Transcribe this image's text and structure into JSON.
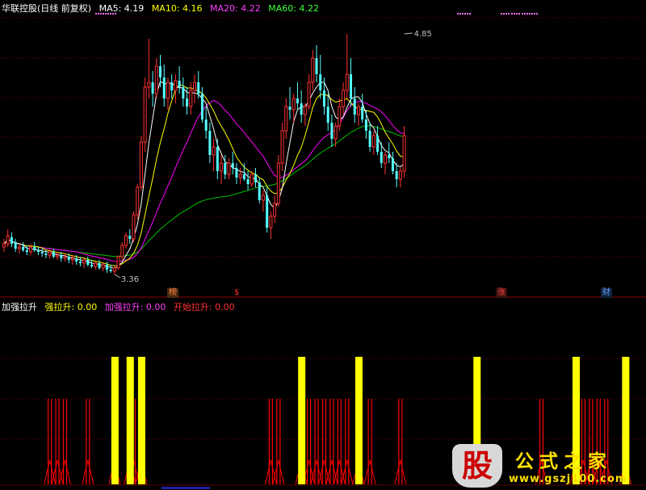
{
  "main_header": {
    "title": "华联控股(日线 前复权)",
    "ma5_label": "MA5: 4.19",
    "ma10_label": "MA10: 4.16",
    "ma20_label": "MA20: 4.22",
    "ma60_label": "MA60: 4.22"
  },
  "indicator_header": {
    "name": "加强拉升",
    "strong_label": "强拉升: 0.00",
    "enhanced_label": "加强拉升: 0.00",
    "start_label": "开始拉升: 0.00"
  },
  "markers": [
    {
      "text": "榜",
      "color": "#ff8040",
      "bg": "#4a2a10"
    },
    {
      "text": "$",
      "color": "#ff3030",
      "bg": "transparent"
    },
    {
      "text": "涨",
      "color": "#ff4040",
      "bg": "#3a1010"
    },
    {
      "text": "财",
      "color": "#60a0ff",
      "bg": "#10203a"
    }
  ],
  "colors": {
    "up": "#ff3232",
    "down": "#54ffff",
    "ma5": "#ffffff",
    "ma10": "#ffff00",
    "ma20": "#ff00ff",
    "ma60": "#00c000",
    "strong_bar": "#ffff00",
    "red_line": "#ff0000",
    "grid": "#7a0000",
    "header_title": "#ffffff",
    "ma5_text": "#ffffff",
    "ma10_text": "#ffff00",
    "ma20_text": "#ff40ff",
    "ma60_text": "#40ff40"
  },
  "watermark": {
    "glyph": "股",
    "title": "公式之家",
    "url": "www.gszj100.com"
  },
  "chart_data": [
    {
      "type": "candlestick",
      "title": "华联控股(日线 前复权)",
      "annotations": [
        {
          "text": "4.85",
          "kind": "high",
          "x": 105,
          "value": 4.85
        },
        {
          "text": "3.36",
          "kind": "low",
          "x": 29,
          "value": 3.36
        }
      ],
      "ylim": [
        3.3,
        4.95
      ],
      "grid": true,
      "candles": [
        [
          3.53,
          3.58,
          3.5,
          3.55
        ],
        [
          3.55,
          3.64,
          3.53,
          3.6
        ],
        [
          3.59,
          3.62,
          3.53,
          3.55
        ],
        [
          3.56,
          3.58,
          3.5,
          3.52
        ],
        [
          3.52,
          3.55,
          3.49,
          3.53
        ],
        [
          3.53,
          3.56,
          3.5,
          3.51
        ],
        [
          3.51,
          3.54,
          3.48,
          3.5
        ],
        [
          3.5,
          3.55,
          3.48,
          3.53
        ],
        [
          3.53,
          3.56,
          3.5,
          3.51
        ],
        [
          3.51,
          3.53,
          3.48,
          3.5
        ],
        [
          3.5,
          3.52,
          3.47,
          3.49
        ],
        [
          3.49,
          3.51,
          3.46,
          3.48
        ],
        [
          3.48,
          3.52,
          3.46,
          3.5
        ],
        [
          3.5,
          3.52,
          3.46,
          3.47
        ],
        [
          3.47,
          3.5,
          3.45,
          3.48
        ],
        [
          3.48,
          3.5,
          3.44,
          3.46
        ],
        [
          3.46,
          3.49,
          3.44,
          3.47
        ],
        [
          3.47,
          3.49,
          3.43,
          3.45
        ],
        [
          3.45,
          3.48,
          3.42,
          3.46
        ],
        [
          3.46,
          3.48,
          3.42,
          3.44
        ],
        [
          3.44,
          3.47,
          3.41,
          3.43
        ],
        [
          3.43,
          3.46,
          3.4,
          3.45
        ],
        [
          3.45,
          3.47,
          3.41,
          3.42
        ],
        [
          3.42,
          3.45,
          3.4,
          3.41
        ],
        [
          3.41,
          3.44,
          3.39,
          3.43
        ],
        [
          3.43,
          3.45,
          3.39,
          3.4
        ],
        [
          3.4,
          3.43,
          3.38,
          3.42
        ],
        [
          3.42,
          3.44,
          3.37,
          3.39
        ],
        [
          3.39,
          3.42,
          3.37,
          3.38
        ],
        [
          3.38,
          3.41,
          3.36,
          3.4
        ],
        [
          3.4,
          3.48,
          3.39,
          3.47
        ],
        [
          3.47,
          3.56,
          3.45,
          3.54
        ],
        [
          3.54,
          3.62,
          3.52,
          3.6
        ],
        [
          3.6,
          3.64,
          3.55,
          3.58
        ],
        [
          3.58,
          3.75,
          3.56,
          3.73
        ],
        [
          3.73,
          3.92,
          3.7,
          3.9
        ],
        [
          3.9,
          4.22,
          3.88,
          4.18
        ],
        [
          4.18,
          4.58,
          4.12,
          4.52
        ],
        [
          4.52,
          4.82,
          4.45,
          4.55
        ],
        [
          4.55,
          4.62,
          4.4,
          4.48
        ],
        [
          4.48,
          4.7,
          4.45,
          4.65
        ],
        [
          4.65,
          4.72,
          4.52,
          4.58
        ],
        [
          4.58,
          4.66,
          4.4,
          4.45
        ],
        [
          4.45,
          4.58,
          4.38,
          4.55
        ],
        [
          4.55,
          4.6,
          4.45,
          4.5
        ],
        [
          4.5,
          4.6,
          4.42,
          4.56
        ],
        [
          4.56,
          4.65,
          4.48,
          4.52
        ],
        [
          4.52,
          4.58,
          4.4,
          4.45
        ],
        [
          4.45,
          4.52,
          4.35,
          4.4
        ],
        [
          4.4,
          4.55,
          4.35,
          4.5
        ],
        [
          4.5,
          4.6,
          4.42,
          4.55
        ],
        [
          4.55,
          4.62,
          4.45,
          4.48
        ],
        [
          4.48,
          4.52,
          4.3,
          4.32
        ],
        [
          4.32,
          4.4,
          4.2,
          4.25
        ],
        [
          4.25,
          4.3,
          4.05,
          4.1
        ],
        [
          4.1,
          4.2,
          4.0,
          4.15
        ],
        [
          4.15,
          4.2,
          3.95,
          4.0
        ],
        [
          4.0,
          4.1,
          3.92,
          4.05
        ],
        [
          4.05,
          4.1,
          3.95,
          3.98
        ],
        [
          3.98,
          4.08,
          3.95,
          4.05
        ],
        [
          4.05,
          4.12,
          3.98,
          4.02
        ],
        [
          4.02,
          4.05,
          3.92,
          3.96
        ],
        [
          3.96,
          4.02,
          3.92,
          3.98
        ],
        [
          3.98,
          4.05,
          3.94,
          3.95
        ],
        [
          3.95,
          4.0,
          3.88,
          3.92
        ],
        [
          3.92,
          4.0,
          3.9,
          3.98
        ],
        [
          3.98,
          4.02,
          3.9,
          3.93
        ],
        [
          3.93,
          3.96,
          3.8,
          3.82
        ],
        [
          3.82,
          3.88,
          3.75,
          3.85
        ],
        [
          3.85,
          3.9,
          3.62,
          3.65
        ],
        [
          3.65,
          3.75,
          3.58,
          3.72
        ],
        [
          3.72,
          3.85,
          3.68,
          3.8
        ],
        [
          3.8,
          4.1,
          3.78,
          4.05
        ],
        [
          4.05,
          4.3,
          4.0,
          4.25
        ],
        [
          4.25,
          4.45,
          4.2,
          4.4
        ],
        [
          4.4,
          4.52,
          4.32,
          4.38
        ],
        [
          4.38,
          4.48,
          4.3,
          4.45
        ],
        [
          4.45,
          4.55,
          4.38,
          4.42
        ],
        [
          4.42,
          4.5,
          4.3,
          4.35
        ],
        [
          4.35,
          4.42,
          4.28,
          4.4
        ],
        [
          4.4,
          4.6,
          4.38,
          4.55
        ],
        [
          4.55,
          4.75,
          4.5,
          4.7
        ],
        [
          4.7,
          4.78,
          4.55,
          4.6
        ],
        [
          4.6,
          4.72,
          4.45,
          4.5
        ],
        [
          4.5,
          4.58,
          4.35,
          4.4
        ],
        [
          4.4,
          4.48,
          4.25,
          4.3
        ],
        [
          4.3,
          4.35,
          4.15,
          4.2
        ],
        [
          4.2,
          4.3,
          4.15,
          4.28
        ],
        [
          4.28,
          4.45,
          4.25,
          4.4
        ],
        [
          4.4,
          4.55,
          4.35,
          4.5
        ],
        [
          4.5,
          4.85,
          4.45,
          4.6
        ],
        [
          4.6,
          4.7,
          4.4,
          4.45
        ],
        [
          4.45,
          4.52,
          4.3,
          4.35
        ],
        [
          4.35,
          4.42,
          4.28,
          4.4
        ],
        [
          4.4,
          4.48,
          4.3,
          4.32
        ],
        [
          4.32,
          4.38,
          4.2,
          4.25
        ],
        [
          4.25,
          4.3,
          4.12,
          4.15
        ],
        [
          4.15,
          4.25,
          4.1,
          4.22
        ],
        [
          4.22,
          4.28,
          4.1,
          4.12
        ],
        [
          4.12,
          4.18,
          4.02,
          4.05
        ],
        [
          4.05,
          4.12,
          3.98,
          4.1
        ],
        [
          4.1,
          4.18,
          4.05,
          4.08
        ],
        [
          4.08,
          4.12,
          3.98,
          4.0
        ],
        [
          4.0,
          4.05,
          3.9,
          3.95
        ],
        [
          3.95,
          4.02,
          3.9,
          4.0
        ],
        [
          4.0,
          4.28,
          3.96,
          4.22
        ]
      ],
      "ma_lines": [
        {
          "name": "MA5",
          "value": 4.19
        },
        {
          "name": "MA10",
          "value": 4.16
        },
        {
          "name": "MA20",
          "value": 4.22
        },
        {
          "name": "MA60",
          "value": 4.22
        }
      ]
    },
    {
      "type": "bar",
      "title": "加强拉升",
      "series": [
        {
          "name": "强拉升",
          "value": 0.0,
          "indices": [
            29,
            33,
            36,
            78,
            93,
            124,
            150,
            163
          ]
        },
        {
          "name": "加强拉升",
          "value": 0.0,
          "indices": []
        },
        {
          "name": "开始拉升",
          "value": 0.0,
          "indices": [
            12,
            14,
            16,
            22,
            29,
            33,
            34,
            36,
            70,
            72,
            78,
            80,
            82,
            84,
            86,
            88,
            90,
            93,
            96,
            104,
            124,
            141,
            150,
            152,
            154,
            156,
            158,
            163
          ]
        }
      ]
    }
  ]
}
